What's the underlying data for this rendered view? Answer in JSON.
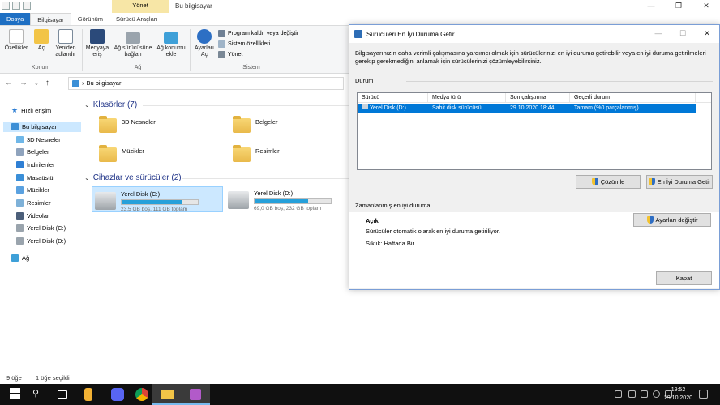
{
  "explorer": {
    "title": "Bu bilgisayar",
    "context_tab_header": "Yönet",
    "tabs": [
      {
        "label": "Dosya"
      },
      {
        "label": "Bilgisayar"
      },
      {
        "label": "Görünüm"
      },
      {
        "label": "Sürücü Araçları"
      }
    ],
    "ribbon": {
      "buttons": {
        "properties": "Özellikler",
        "open": "Aç",
        "rename": "Yeniden adlandır",
        "media": "Medyaya eriş",
        "map_drive": "Ağ sürücüsüne bağlan",
        "add_location": "Ağ konumu ekle",
        "settings": "Ayarları Aç",
        "uninstall": "Program kaldır veya değiştir",
        "sys_props": "Sistem özellikleri",
        "manage": "Yönet"
      },
      "groups": {
        "konum": "Konum",
        "ag": "Ağ",
        "sistem": "Sistem"
      }
    },
    "address": {
      "path": "Bu bilgisayar"
    },
    "sidebar": {
      "quick_access": "Hızlı erişim",
      "this_pc": "Bu bilgisayar",
      "items": [
        {
          "label": "3D Nesneler",
          "color": "#6fb7e8"
        },
        {
          "label": "Belgeler",
          "color": "#8fa3bd"
        },
        {
          "label": "İndirilenler",
          "color": "#2f7fd4"
        },
        {
          "label": "Masaüstü",
          "color": "#3a8fd8"
        },
        {
          "label": "Müzikler",
          "color": "#5aa1e0"
        },
        {
          "label": "Resimler",
          "color": "#7eb1d8"
        },
        {
          "label": "Videolar",
          "color": "#4c5f7a"
        },
        {
          "label": "Yerel Disk (C:)",
          "color": "#9aa4ad"
        },
        {
          "label": "Yerel Disk (D:)",
          "color": "#9aa4ad"
        }
      ],
      "network": "Ağ"
    },
    "sections": {
      "folders": "Klasörler (7)",
      "devices": "Cihazlar ve sürücüler (2)"
    },
    "folders": [
      {
        "label": "3D Nesneler"
      },
      {
        "label": "Belgeler"
      },
      {
        "label": "Müzikler"
      },
      {
        "label": "Resimler"
      }
    ],
    "drives": [
      {
        "name": "Yerel Disk (C:)",
        "size": "23,5 GB boş, 111 GB toplam",
        "used_fraction": 0.79
      },
      {
        "name": "Yerel Disk (D:)",
        "size": "69,0 GB boş, 232 GB toplam",
        "used_fraction": 0.7
      }
    ],
    "status": {
      "count": "9 öğe",
      "selected": "1 öğe seçildi"
    }
  },
  "dialog": {
    "title": "Sürücüleri En İyi Duruma Getir",
    "description": "Bilgisayarınızın daha verimli çalışmasına yardımcı olmak için sürücülerinizi en iyi duruma getirebilir veya en iyi duruma getirilmeleri gerekip gerekmediğini anlamak için sürücülerinizi çözümleyebilirsiniz.",
    "status_label": "Durum",
    "columns": [
      "Sürücü",
      "Medya türü",
      "Son çalıştırma",
      "Geçerli durum"
    ],
    "rows": [
      {
        "drive": "Yerel Disk (D:)",
        "media": "Sabit disk sürücüsü",
        "last_run": "29.10.2020 18:44",
        "status": "Tamam (%0 parçalanmış)"
      }
    ],
    "analyze_button": "Çözümle",
    "optimize_button": "En İyi Duruma Getir",
    "scheduled_label": "Zamanlanmış en iyi duruma",
    "scheduled_state": "Açık",
    "scheduled_desc": "Sürücüler otomatik olarak en iyi duruma getiriliyor.",
    "frequency": "Sıklık: Haftada Bir",
    "change_settings_button": "Ayarları değiştir",
    "close_button": "Kapat"
  },
  "taskbar": {
    "time": "19:52",
    "date": "29.10.2020"
  }
}
